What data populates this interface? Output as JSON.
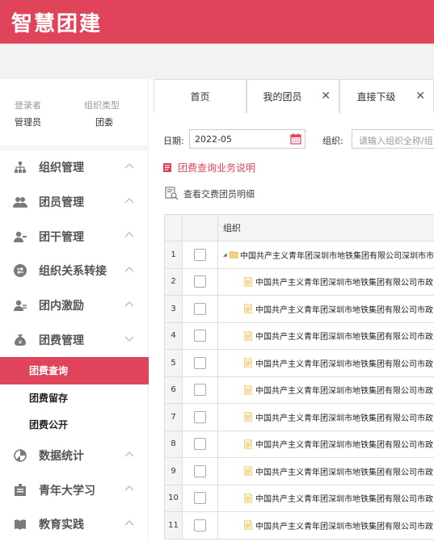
{
  "app": {
    "brand": "智慧团建"
  },
  "user": {
    "login_label": "登录者",
    "login_value": "管理员",
    "orgtype_label": "组织类型",
    "orgtype_value": "团委"
  },
  "sidebar": {
    "items": [
      {
        "label": "组织管理",
        "icon": "org-chart-icon",
        "expanded": false
      },
      {
        "label": "团员管理",
        "icon": "members-icon",
        "expanded": false
      },
      {
        "label": "团干管理",
        "icon": "cadre-icon",
        "expanded": false
      },
      {
        "label": "组织关系转接",
        "icon": "transfer-icon",
        "expanded": false
      },
      {
        "label": "团内激励",
        "icon": "incentive-icon",
        "expanded": false
      },
      {
        "label": "团费管理",
        "icon": "money-bag-icon",
        "expanded": true,
        "children": [
          {
            "label": "团费查询",
            "active": true
          },
          {
            "label": "团费留存",
            "active": false
          },
          {
            "label": "团费公开",
            "active": false
          }
        ]
      },
      {
        "label": "数据统计",
        "icon": "pie-chart-icon",
        "expanded": false
      },
      {
        "label": "青年大学习",
        "icon": "study-icon",
        "expanded": false
      },
      {
        "label": "教育实践",
        "icon": "book-icon",
        "expanded": false
      }
    ]
  },
  "tabs": [
    {
      "label": "首页",
      "closable": false
    },
    {
      "label": "我的团员",
      "closable": true
    },
    {
      "label": "直接下级",
      "closable": true
    }
  ],
  "filters": {
    "date_label": "日期:",
    "date_value": "2022-05",
    "org_label": "组织:",
    "org_placeholder": "请输入组织全称/组..."
  },
  "notice": "团费查询业务说明",
  "view_detail": "查看交费团员明细",
  "table": {
    "header": "组织",
    "rows": [
      {
        "idx": "1",
        "org": "中国共产主义青年团深圳市地铁集团有限公司深圳市市",
        "type": "folder"
      },
      {
        "idx": "2",
        "org": "中国共产主义青年团深圳市地铁集团有限公司市政",
        "type": "file"
      },
      {
        "idx": "3",
        "org": "中国共产主义青年团深圳市地铁集团有限公司市政",
        "type": "file"
      },
      {
        "idx": "4",
        "org": "中国共产主义青年团深圳市地铁集团有限公司市政",
        "type": "file"
      },
      {
        "idx": "5",
        "org": "中国共产主义青年团深圳市地铁集团有限公司市政",
        "type": "file"
      },
      {
        "idx": "6",
        "org": "中国共产主义青年团深圳市地铁集团有限公司市政",
        "type": "file"
      },
      {
        "idx": "7",
        "org": "中国共产主义青年团深圳市地铁集团有限公司市政",
        "type": "file"
      },
      {
        "idx": "8",
        "org": "中国共产主义青年团深圳市地铁集团有限公司市政",
        "type": "file"
      },
      {
        "idx": "9",
        "org": "中国共产主义青年团深圳市地铁集团有限公司市政",
        "type": "file"
      },
      {
        "idx": "10",
        "org": "中国共产主义青年团深圳市地铁集团有限公司市政",
        "type": "file"
      },
      {
        "idx": "11",
        "org": "中国共产主义青年团深圳市地铁集团有限公司市政",
        "type": "file"
      }
    ]
  },
  "colors": {
    "brand": "#e0445a",
    "muted": "#999999"
  }
}
